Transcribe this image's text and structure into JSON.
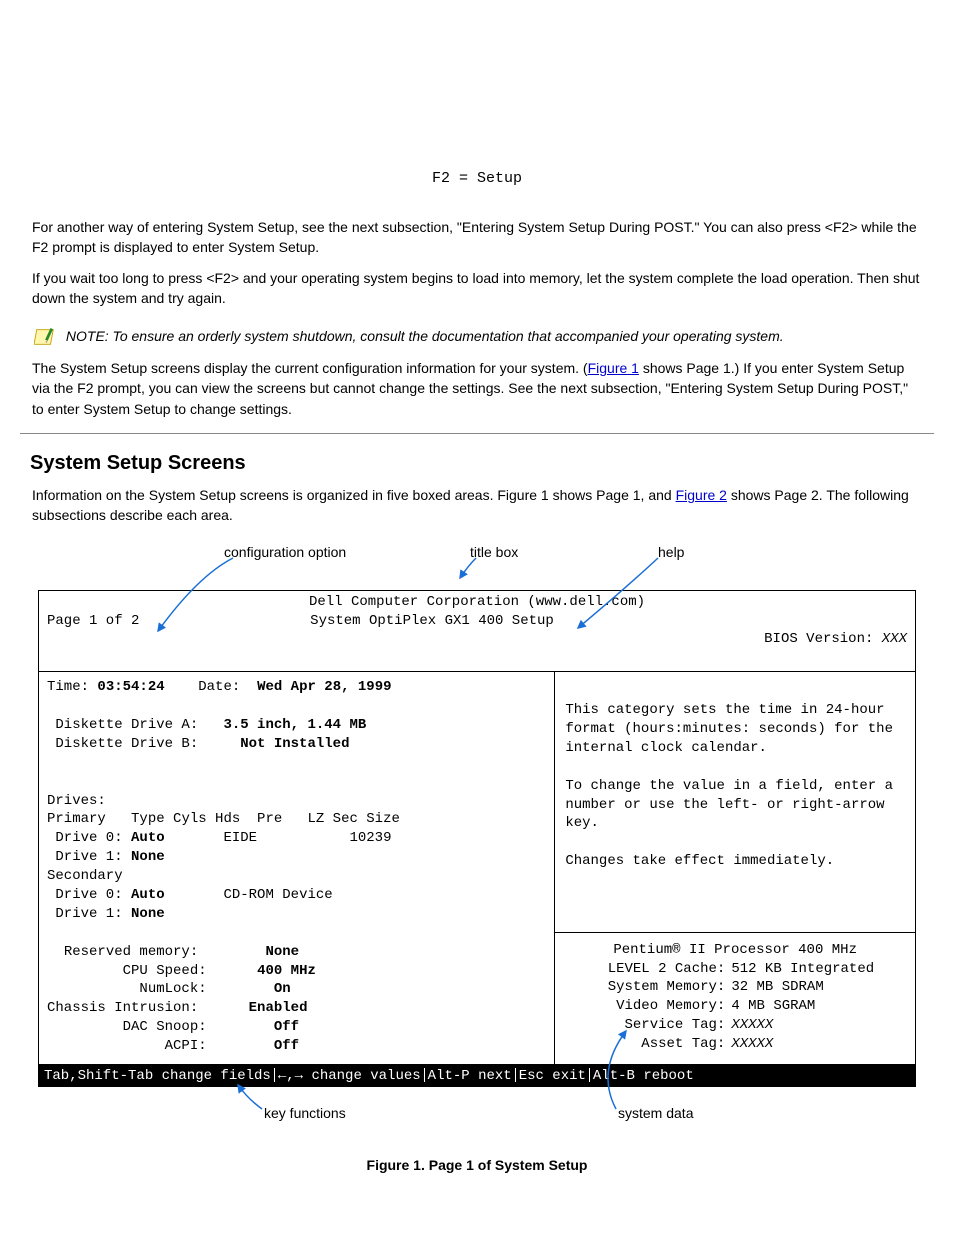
{
  "prompt": "F2 = Setup",
  "intro1": "For another way of entering System Setup, see the next subsection, \"Entering System Setup During POST.\" You can also press <F2> while the F2 prompt is displayed to enter System Setup.",
  "intro2": "If you wait too long to press <F2> and your operating system begins to load into memory, let the system complete the load operation. Then shut down the system and try again.",
  "note_label": "NOTE:",
  "note_text": " To ensure an orderly system shutdown, consult the documentation that accompanied your operating system.",
  "note_tail": "The System Setup screens display the current configuration information for your system. (",
  "figure_link": "Figure 1",
  "note_tail2": " shows Page 1.) If you enter System Setup via the F2 prompt, you can view the screens but cannot change the settings. See the next subsection, \"Entering System Setup During POST,\" to enter System Setup to change settings.",
  "section_heading": "System Setup Screens",
  "section_p1": "Information on the System Setup screens is organized in five boxed areas. Figure 1 shows Page 1, and ",
  "figure2_link": "Figure 2",
  "section_p1b": " shows Page 2. The following subsections describe each area.",
  "anno": {
    "config": "configuration option",
    "titlebox": "title box",
    "help": "help",
    "keyfunc": "key functions",
    "sysdata": "system data"
  },
  "title": {
    "line1": "Dell Computer Corporation (www.dell.com)",
    "page": "Page 1 of 2",
    "center": "System OptiPlex GX1 400 Setup",
    "bios_label": "BIOS Version: ",
    "bios_val": "XXX"
  },
  "left": {
    "time_label": "Time:",
    "time_val": "03:54:24",
    "date_label": "Date:",
    "date_val": "Wed Apr 28, 1999",
    "dda_label": "Diskette Drive A:",
    "dda_val": "3.5 inch, 1.44 MB",
    "ddb_label": "Diskette Drive B:",
    "ddb_val": "Not Installed",
    "drives_header": "Drives:",
    "primary_label": "Primary",
    "columns": "Type Cyls Hds  Pre   LZ Sec Size",
    "p0_label": " Drive 0:",
    "p0_type": "Auto",
    "p0_extra": "EIDE           10239",
    "p1_label": " Drive 1:",
    "p1_type": "None",
    "secondary_label": "Secondary",
    "s0_label": " Drive 0:",
    "s0_type": "Auto",
    "s0_extra": "CD-ROM Device",
    "s1_label": " Drive 1:",
    "s1_type": "None",
    "resmem_label": "Reserved memory:",
    "resmem_val": "None",
    "cpu_label": "CPU Speed:",
    "cpu_val": "400 MHz",
    "num_label": "NumLock:",
    "num_val": "On",
    "chassis_label": "Chassis Intrusion:",
    "chassis_val": "Enabled",
    "dac_label": "DAC Snoop:",
    "dac_val": "Off",
    "acpi_label": "ACPI:",
    "acpi_val": "Off"
  },
  "help": {
    "p1": "This category sets the time in 24-hour format (hours:minutes: seconds) for the internal clock calendar.",
    "p2": "To change the value in a field, enter a number or use the left- or right-arrow key.",
    "p3": "Changes take effect immediately."
  },
  "sysdata": {
    "cpu_line": "Pentium® II Processor 400 MHz",
    "l2_label": "LEVEL 2 Cache:",
    "l2_val": "512 KB Integrated",
    "sysmem_label": "System Memory:",
    "sysmem_val": "32 MB SDRAM",
    "vidmem_label": "Video Memory:",
    "vidmem_val": "4 MB SGRAM",
    "svc_label": "Service Tag:",
    "svc_val": "XXXXX",
    "asset_label": "Asset Tag:",
    "asset_val": "XXXXX"
  },
  "footer": {
    "f1": "Tab,Shift-Tab change fields",
    "f2": "←,→ change values",
    "f3": "Alt-P next",
    "f4": "Esc exit",
    "f5": "Alt-B reboot"
  },
  "figure_caption": "Figure 1. Page 1 of System Setup"
}
